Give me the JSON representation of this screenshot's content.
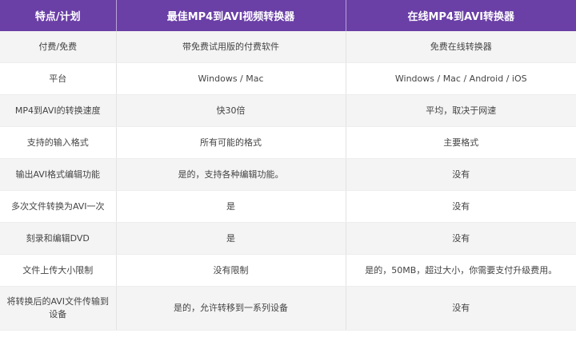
{
  "header": {
    "feature": "特点/计划",
    "desktop": "最佳MP4到AVI视频转换器",
    "online": "在线MP4到AVI转换器"
  },
  "rows": [
    {
      "feature": "付费/免费",
      "desktop": "带免费试用版的付费软件",
      "online": "免费在线转换器"
    },
    {
      "feature": "平台",
      "desktop": "Windows / Mac",
      "online": "Windows / Mac / Android / iOS"
    },
    {
      "feature": "MP4到AVI的转换速度",
      "desktop": "快30倍",
      "online": "平均，取决于网速"
    },
    {
      "feature": "支持的输入格式",
      "desktop": "所有可能的格式",
      "online": "主要格式"
    },
    {
      "feature": "输出AVI格式编辑功能",
      "desktop": "是的，支持各种编辑功能。",
      "online": "没有"
    },
    {
      "feature": "多次文件转换为AVI一次",
      "desktop": "是",
      "online": "没有"
    },
    {
      "feature": "刻录和编辑DVD",
      "desktop": "是",
      "online": "没有"
    },
    {
      "feature": "文件上传大小限制",
      "desktop": "没有限制",
      "online": "是的，50MB，超过大小，你需要支付升级费用。"
    },
    {
      "feature": "将转换后的AVI文件传输到设备",
      "desktop": "是的，允许转移到一系列设备",
      "online": "没有"
    }
  ]
}
